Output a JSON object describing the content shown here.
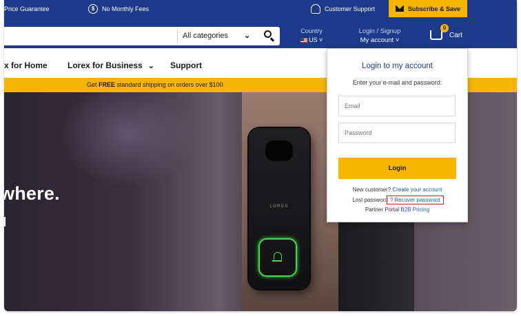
{
  "topbar": {
    "price_guarantee": "Price Guarantee",
    "no_fees": "No Monthly Fees",
    "support": "Customer Support",
    "subscribe": "Subscribe & Save"
  },
  "header": {
    "search": {
      "category": "All categories",
      "placeholder": ""
    },
    "country": {
      "label": "Country",
      "value": "US"
    },
    "account": {
      "label": "Login / Signup",
      "value": "My account"
    },
    "cart": {
      "label": "Cart",
      "count": "0"
    }
  },
  "nav": {
    "items": [
      {
        "label": "x for Home"
      },
      {
        "label": "Lorex for Business"
      },
      {
        "label": "Support"
      }
    ]
  },
  "shipping": {
    "prefix": "Get ",
    "bold": "FREE",
    "suffix": " standard shipping on orders over $100"
  },
  "hero": {
    "headline": "where.",
    "device_logo": "LOREX"
  },
  "login_panel": {
    "title": "Login to my account",
    "subtitle": "Enter your e-mail and password:",
    "email_placeholder": "Email",
    "password_placeholder": "Password",
    "login_button": "Login",
    "new_customer_text": "New customer? ",
    "create_account_link": "Create your account",
    "lost_password_text": "Lost password",
    "recover_password_link": "? Recover password",
    "partner_text": "Partner Portal ",
    "b2b_link": "B2B Pricing"
  },
  "colors": {
    "brand_blue": "#1d3a8a",
    "accent_yellow": "#f7b500",
    "highlight_red": "#d62020"
  }
}
